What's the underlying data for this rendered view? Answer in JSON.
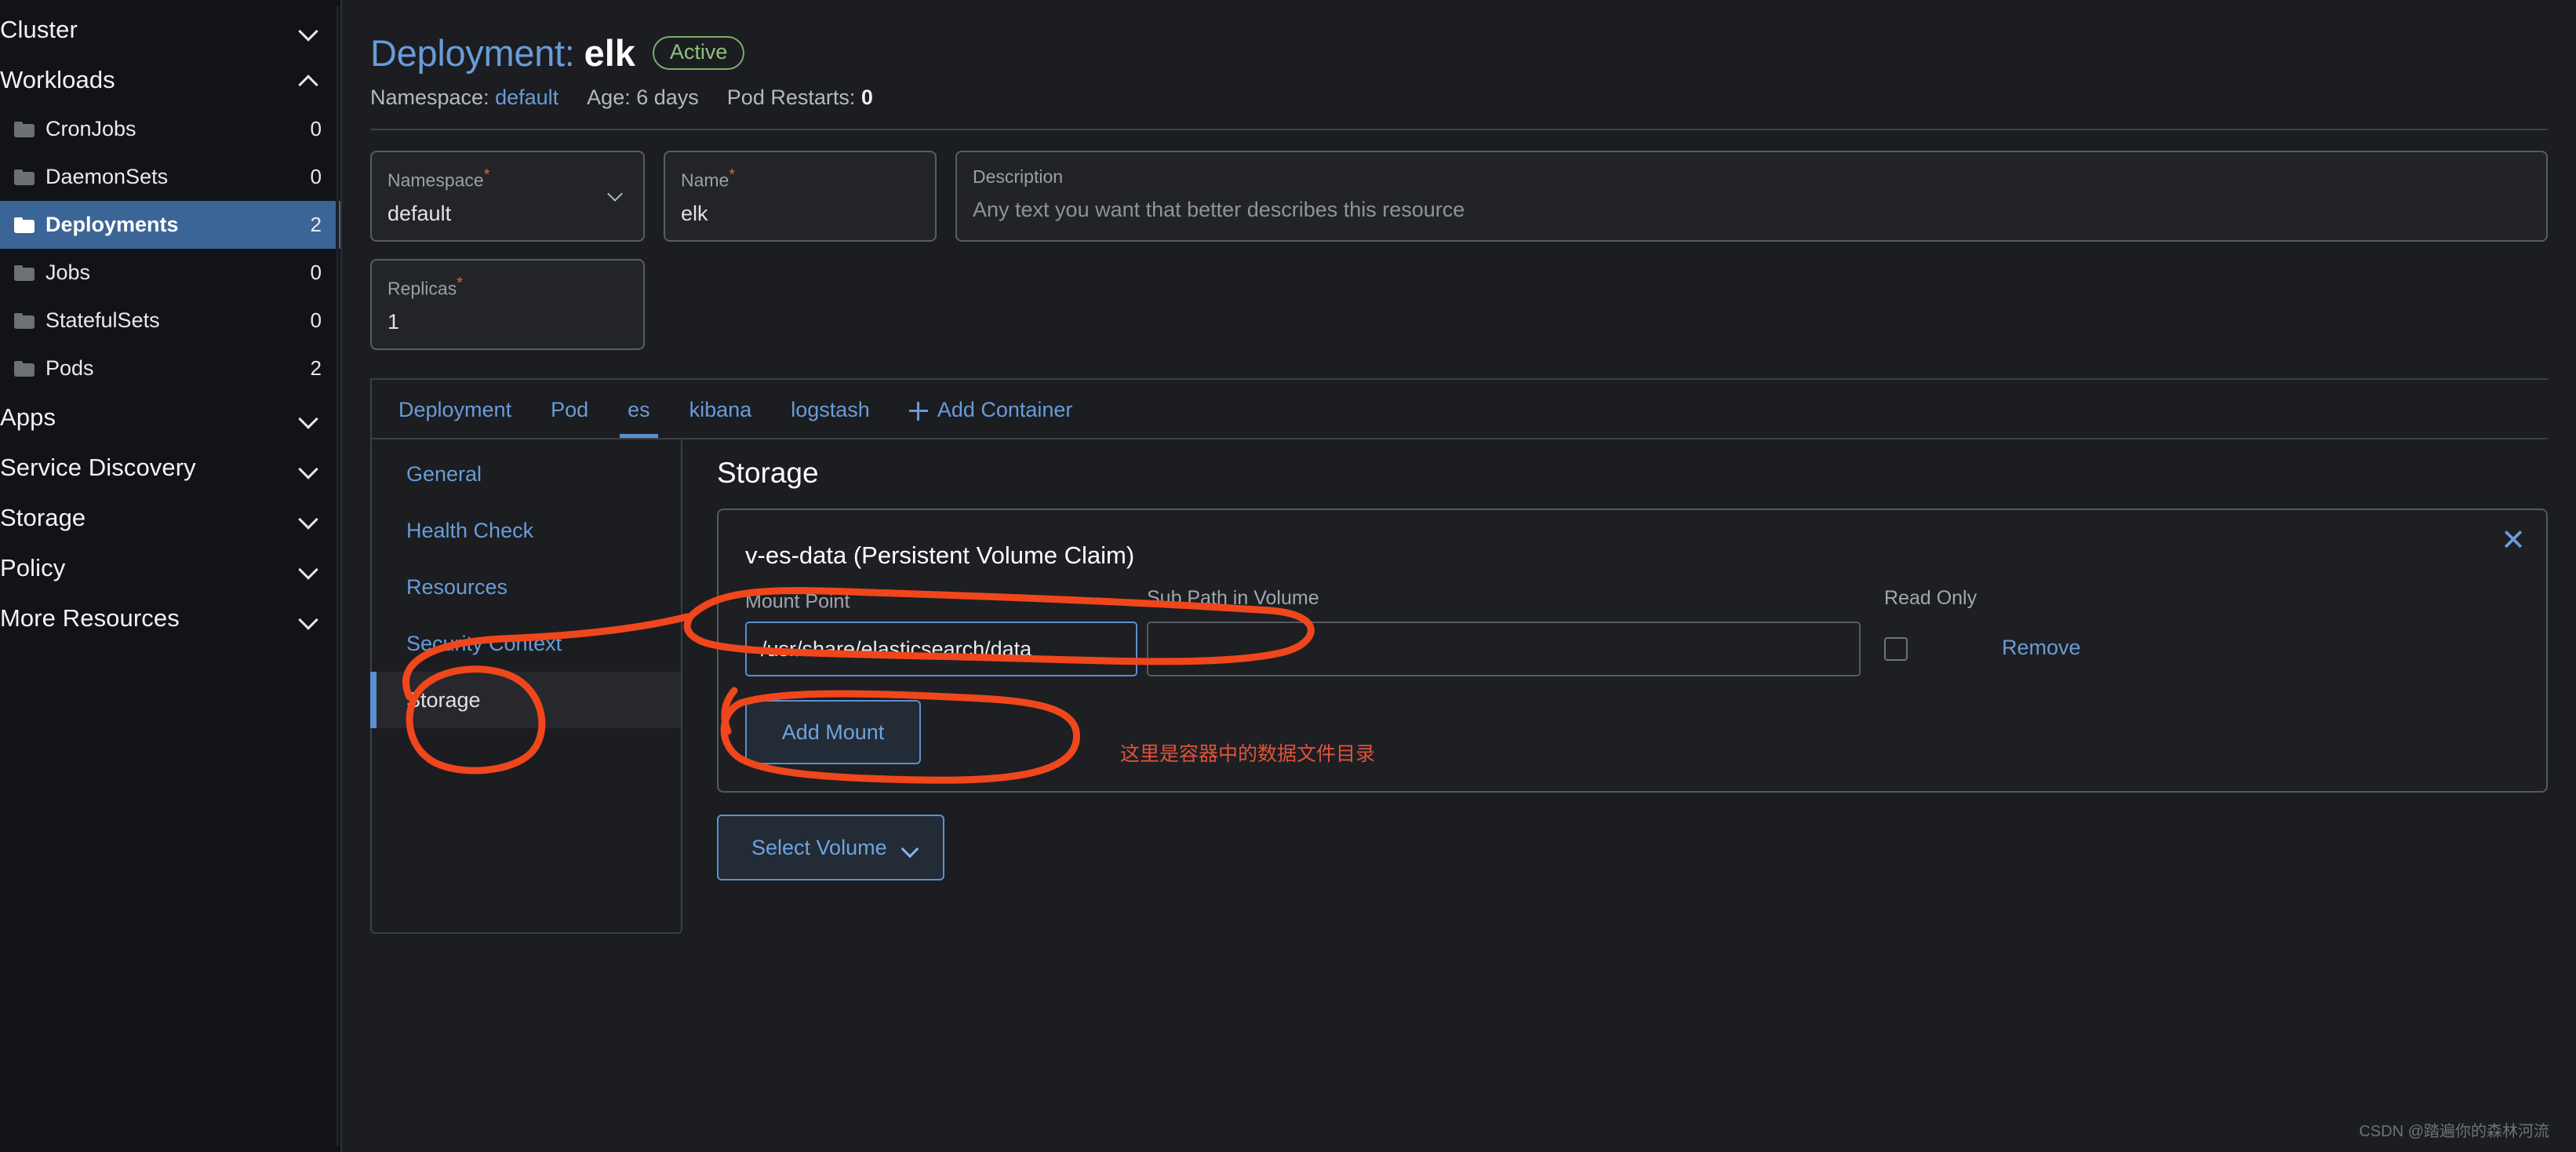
{
  "sidebar": {
    "groups": [
      {
        "label": "Cluster",
        "state": "collapsed",
        "icon": "chevron-down-icon",
        "items": []
      },
      {
        "label": "Workloads",
        "state": "expanded",
        "icon": "chevron-up-icon",
        "items": [
          {
            "label": "CronJobs",
            "count": "0",
            "icon": "folder-icon",
            "active": false
          },
          {
            "label": "DaemonSets",
            "count": "0",
            "icon": "folder-icon",
            "active": false
          },
          {
            "label": "Deployments",
            "count": "2",
            "icon": "folder-icon",
            "active": true
          },
          {
            "label": "Jobs",
            "count": "0",
            "icon": "folder-icon",
            "active": false
          },
          {
            "label": "StatefulSets",
            "count": "0",
            "icon": "folder-icon",
            "active": false
          },
          {
            "label": "Pods",
            "count": "2",
            "icon": "folder-icon",
            "active": false
          }
        ]
      },
      {
        "label": "Apps",
        "state": "collapsed",
        "icon": "chevron-down-icon",
        "items": []
      },
      {
        "label": "Service Discovery",
        "state": "collapsed",
        "icon": "chevron-down-icon",
        "items": []
      },
      {
        "label": "Storage",
        "state": "collapsed",
        "icon": "chevron-down-icon",
        "items": []
      },
      {
        "label": "Policy",
        "state": "collapsed",
        "icon": "chevron-down-icon",
        "items": []
      },
      {
        "label": "More Resources",
        "state": "collapsed",
        "icon": "chevron-down-icon",
        "items": []
      }
    ]
  },
  "header": {
    "kind_label": "Deployment:",
    "resource_name": "elk",
    "status_badge": "Active",
    "meta": {
      "namespace_label": "Namespace:",
      "namespace_value": "default",
      "age_label": "Age:",
      "age_value": "6 days",
      "restarts_label": "Pod Restarts:",
      "restarts_value": "0"
    }
  },
  "form": {
    "namespace": {
      "label": "Namespace",
      "required": "*",
      "value": "default"
    },
    "name": {
      "label": "Name",
      "required": "*",
      "value": "elk"
    },
    "description": {
      "label": "Description",
      "placeholder": "Any text you want that better describes this resource",
      "value": ""
    },
    "replicas": {
      "label": "Replicas",
      "required": "*",
      "value": "1"
    }
  },
  "tabs": {
    "items": [
      {
        "label": "Deployment",
        "active": false
      },
      {
        "label": "Pod",
        "active": false
      },
      {
        "label": "es",
        "active": true
      },
      {
        "label": "kibana",
        "active": false
      },
      {
        "label": "logstash",
        "active": false
      }
    ],
    "add_container": "Add Container",
    "add_icon": "plus-icon"
  },
  "subnav": {
    "items": [
      {
        "label": "General",
        "active": false
      },
      {
        "label": "Health Check",
        "active": false
      },
      {
        "label": "Resources",
        "active": false
      },
      {
        "label": "Security Context",
        "active": false
      },
      {
        "label": "Storage",
        "active": true
      }
    ]
  },
  "storage_panel": {
    "title": "Storage",
    "volume": {
      "name": "v-es-data (Persistent Volume Claim)",
      "close_icon": "close-icon",
      "mount_point_label": "Mount Point",
      "mount_point_required": "*",
      "mount_point_value": "/usr/share/elasticsearch/data",
      "sub_path_label": "Sub Path in Volume",
      "sub_path_value": "",
      "read_only_label": "Read Only",
      "read_only_checked": false,
      "remove_label": "Remove",
      "add_mount_label": "Add Mount"
    },
    "select_volume_label": "Select Volume",
    "select_volume_icon": "chevron-down-icon"
  },
  "annotations": {
    "chinese_note": "这里是容器中的数据文件目录",
    "ink_color": "#f0461c"
  },
  "watermark": "CSDN @踏遍你的森林河流",
  "colors": {
    "accent_blue": "#6a9bd8",
    "active_row": "#3b6596",
    "status_green": "#8fc07f",
    "required_red": "#e0604c",
    "ink_orange": "#f0461c"
  }
}
